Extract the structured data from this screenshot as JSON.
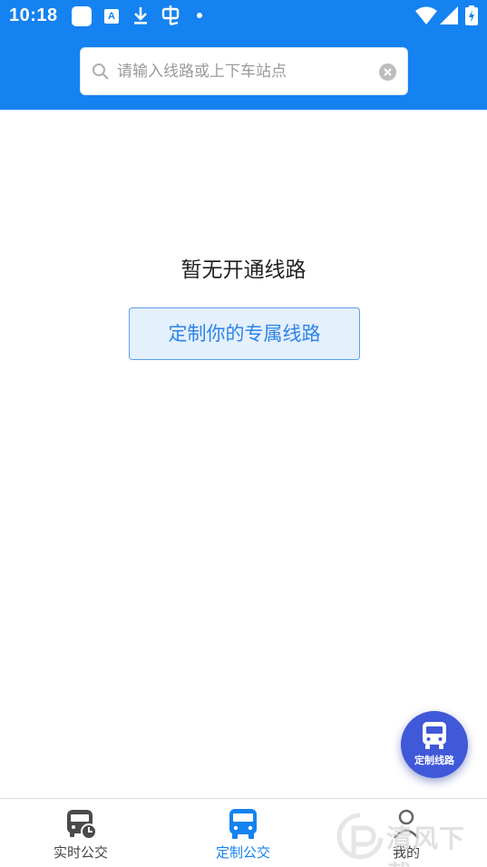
{
  "status_bar": {
    "time": "10:18",
    "icons": [
      "app-square-icon",
      "a-box-icon",
      "download-icon",
      "bug-icon",
      "dot-icon",
      "wifi-icon",
      "signal-icon",
      "battery-icon"
    ]
  },
  "search": {
    "placeholder": "请输入线路或上下车站点",
    "value": ""
  },
  "empty_state": {
    "title": "暂无开通线路",
    "button_label": "定制你的专属线路"
  },
  "fab": {
    "label": "定制线路"
  },
  "bottom_nav": {
    "items": [
      {
        "label": "实时公交",
        "icon": "bus-clock-icon",
        "active": false
      },
      {
        "label": "定制公交",
        "icon": "bus-icon",
        "active": true
      },
      {
        "label": "我的",
        "icon": "person-icon",
        "active": false
      }
    ]
  },
  "watermark": {
    "text": "清风下载"
  },
  "colors": {
    "primary": "#1482f0",
    "button_fill": "#e4f0fc",
    "button_border": "#5c9ee8",
    "fab": "#3f59d8",
    "inactive_icon": "#4a4a4a"
  }
}
